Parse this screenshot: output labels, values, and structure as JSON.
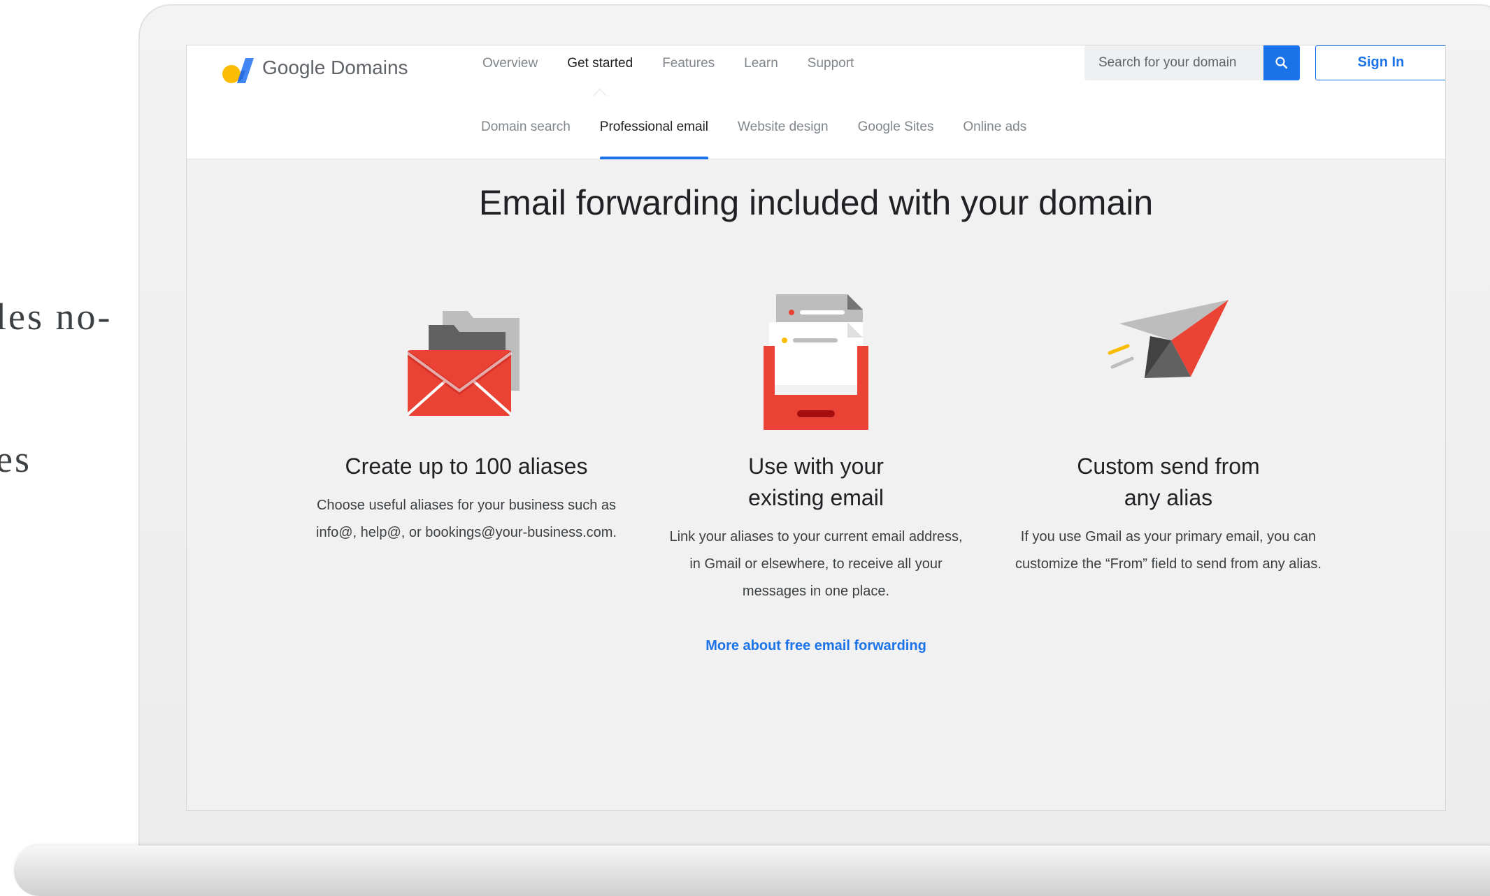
{
  "side_text": {
    "line1": "les no-",
    "line2": "es"
  },
  "header": {
    "brand": "Google Domains",
    "nav": [
      {
        "label": "Overview"
      },
      {
        "label": "Get started",
        "active": true
      },
      {
        "label": "Features"
      },
      {
        "label": "Learn"
      },
      {
        "label": "Support"
      }
    ],
    "search_placeholder": "Search for your domain",
    "search_icon": "search-icon",
    "signin_label": "Sign In"
  },
  "subnav": [
    {
      "label": "Domain search"
    },
    {
      "label": "Professional email",
      "active": true
    },
    {
      "label": "Website design"
    },
    {
      "label": "Google Sites"
    },
    {
      "label": "Online ads"
    }
  ],
  "main": {
    "headline": "Email forwarding included with your domain",
    "features": [
      {
        "icon": "envelope-folder-illustration",
        "title": "Create up to 100 aliases",
        "description": "Choose useful aliases for your business such as info@, help@, or bookings@your-business.com."
      },
      {
        "icon": "inbox-tray-illustration",
        "title": "Use with your existing email",
        "description": "Link your aliases to your current email address, in Gmail or elsewhere, to receive all your messages in one place."
      },
      {
        "icon": "paper-plane-illustration",
        "title": "Custom send from any alias",
        "description": "If you use Gmail as your primary email, you can customize the “From” field to send from any alias."
      }
    ],
    "more_link": "More about free email forwarding"
  },
  "colors": {
    "accent": "#1a73e8",
    "red": "#ea4335",
    "background": "#f1f1f1"
  }
}
